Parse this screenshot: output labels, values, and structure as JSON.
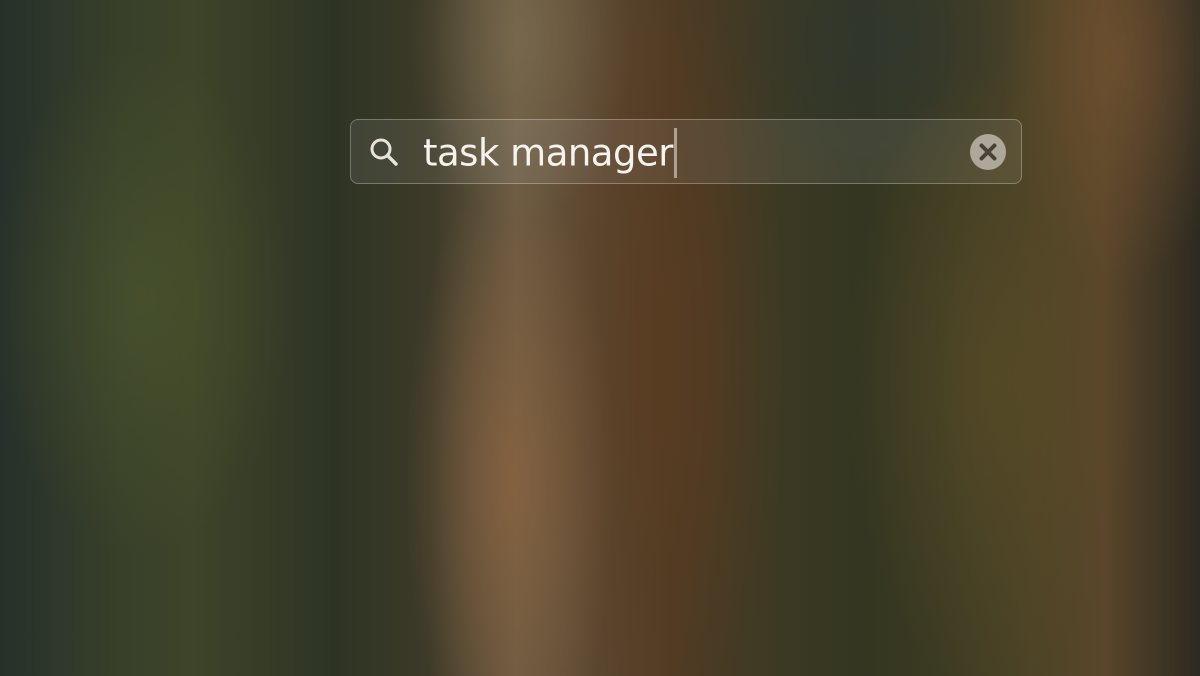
{
  "spotlight": {
    "query": "task manager",
    "icons": {
      "search": "search-icon",
      "clear": "clear-circle-x-icon"
    }
  },
  "colors": {
    "text": "#f6f3ee",
    "icon": "#e8e4dc",
    "clear_icon_bg": "#bdb7ac"
  }
}
